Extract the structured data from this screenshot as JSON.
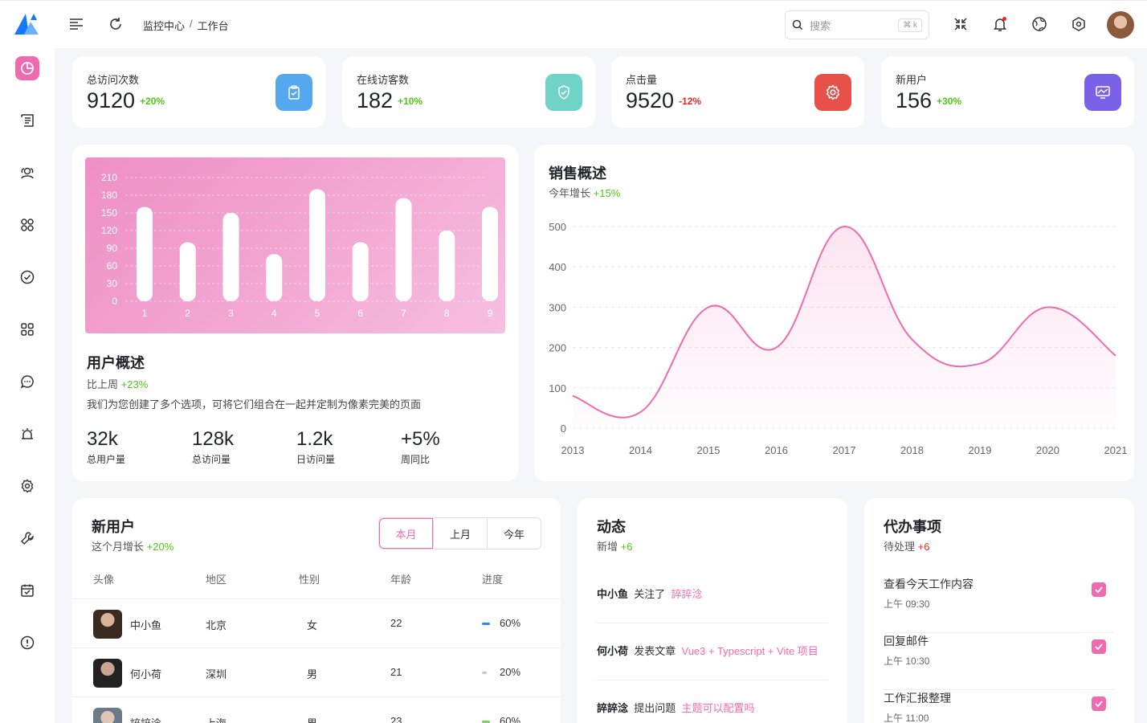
{
  "header": {
    "breadcrumb": [
      "监控中心",
      "工作台"
    ],
    "search": {
      "placeholder": "搜索",
      "shortcut": "⌘ k"
    }
  },
  "colors": {
    "accent": "#f06ab0",
    "positive": "#52c41a",
    "negative": "#f5222d"
  },
  "stats": [
    {
      "label": "总访问次数",
      "value": "9120",
      "delta": "+20%",
      "icon": "clipboard-check-icon",
      "color": "#56a8ee"
    },
    {
      "label": "在线访客数",
      "value": "182",
      "delta": "+10%",
      "icon": "shield-check-icon",
      "color": "#6fd3c8"
    },
    {
      "label": "点击量",
      "value": "9520",
      "delta": "-12%",
      "icon": "gear-icon",
      "color": "#e8514a"
    },
    {
      "label": "新用户",
      "value": "156",
      "delta": "+30%",
      "icon": "monitor-icon",
      "color": "#7b61e8"
    }
  ],
  "user_overview": {
    "title": "用户概述",
    "sub_label": "比上周",
    "sub_delta": "+23%",
    "desc": "我们为您创建了多个选项，可将它们组合在一起并定制为像素完美的页面",
    "stats": [
      {
        "value": "32k",
        "label": "总用户量"
      },
      {
        "value": "128k",
        "label": "总访问量"
      },
      {
        "value": "1.2k",
        "label": "日访问量"
      },
      {
        "value": "+5%",
        "label": "周同比"
      }
    ]
  },
  "sales": {
    "title": "销售概述",
    "sub_label": "今年增长",
    "sub_delta": "+15%"
  },
  "chart_data": [
    {
      "type": "bar",
      "categories": [
        "1",
        "2",
        "3",
        "4",
        "5",
        "6",
        "7",
        "8",
        "9"
      ],
      "values": [
        160,
        100,
        150,
        80,
        190,
        100,
        175,
        120,
        160
      ],
      "yticks": [
        0,
        30,
        60,
        90,
        120,
        150,
        180,
        210
      ],
      "ylim": [
        0,
        210
      ],
      "grid": true
    },
    {
      "type": "area",
      "x": [
        "2013",
        "2014",
        "2015",
        "2016",
        "2017",
        "2018",
        "2019",
        "2020",
        "2021"
      ],
      "values": [
        80,
        40,
        300,
        200,
        500,
        220,
        160,
        300,
        180
      ],
      "yticks": [
        0,
        100,
        200,
        300,
        400,
        500
      ],
      "ylim": [
        0,
        500
      ],
      "grid": true
    }
  ],
  "new_users": {
    "title": "新用户",
    "sub_label": "这个月增长",
    "sub_delta": "+20%",
    "tabs": [
      "本月",
      "上月",
      "今年"
    ],
    "columns": [
      "头像",
      "地区",
      "性别",
      "年龄",
      "进度"
    ],
    "rows": [
      {
        "name": "中小鱼",
        "region": "北京",
        "gender": "女",
        "age": "22",
        "progress": "60%",
        "progress_value": 0.6,
        "bar_color": "#3b82f6"
      },
      {
        "name": "何小荷",
        "region": "深圳",
        "gender": "男",
        "age": "21",
        "progress": "20%",
        "progress_value": 0.2,
        "bar_color": "#c7c4f5"
      },
      {
        "name": "誶誶淰",
        "region": "上海",
        "gender": "男",
        "age": "23",
        "progress": "60%",
        "progress_value": 0.6,
        "bar_color": "#7ccf6a"
      }
    ]
  },
  "activity": {
    "title": "动态",
    "sub_label": "新增",
    "sub_delta": "+6",
    "items": [
      {
        "who": "中小鱼",
        "action": "关注了",
        "target": "誶誶淰"
      },
      {
        "who": "何小荷",
        "action": "发表文章",
        "target": "Vue3 + Typescript + Vite 项目"
      },
      {
        "who": "誶誶淰",
        "action": "提出问题",
        "target": "主题可以配置吗"
      }
    ]
  },
  "todos": {
    "title": "代办事项",
    "sub_label": "待处理",
    "sub_delta": "+6",
    "items": [
      {
        "title": "查看今天工作内容",
        "time": "上午 09:30"
      },
      {
        "title": "回复邮件",
        "time": "上午 10:30"
      },
      {
        "title": "工作汇报整理",
        "time": "上午 11:00"
      }
    ]
  }
}
